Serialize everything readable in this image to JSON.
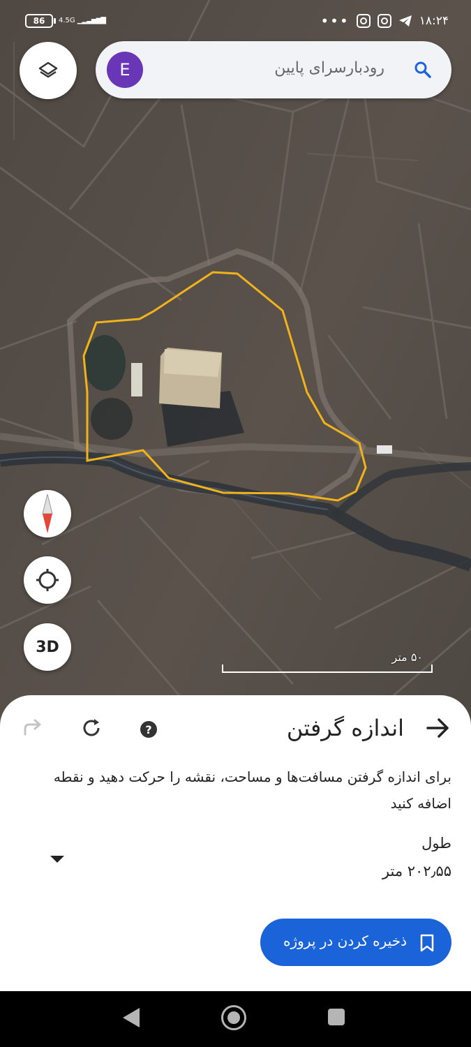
{
  "status_bar": {
    "time": "۱۸:۲۴",
    "battery": "86",
    "network": "4.5G",
    "overflow": "•••",
    "icons": [
      "telegram-icon",
      "instagram-icon",
      "instagram-icon"
    ]
  },
  "search": {
    "avatar_letter": "E",
    "query": "رودبارسرای پایین"
  },
  "map_controls": {
    "threed_label": "3D"
  },
  "scale": {
    "label": "۵۰ متر"
  },
  "measure_panel": {
    "title": "اندازه گرفتن",
    "instructions": "برای اندازه گرفتن مسافت‌ها و مساحت، نقشه را حرکت دهید و نقطه اضافه کنید",
    "distance_label": "طول",
    "distance_value": "۲۰۲٫۵۵ متر",
    "save_label": "ذخیره کردن در پروژه"
  },
  "colors": {
    "accent": "#1a63d8",
    "polygon": "#f2b21c",
    "avatar": "#6a36b8"
  }
}
